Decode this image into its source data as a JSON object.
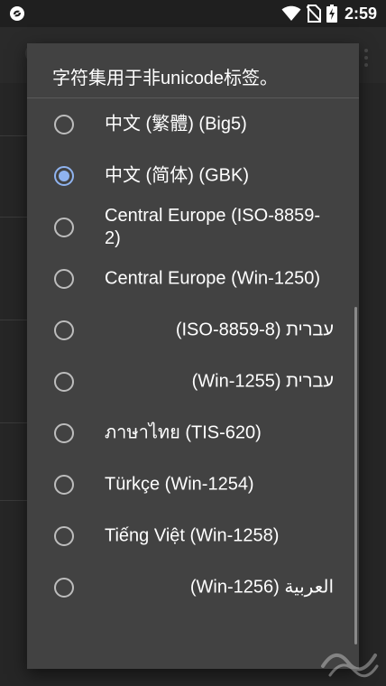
{
  "status_bar": {
    "time": "2:59",
    "icons": [
      "app-notification-icon",
      "wifi-icon",
      "no-sim-icon",
      "battery-charging-icon"
    ]
  },
  "dialog": {
    "title": "字符集用于非unicode标签。",
    "options": [
      {
        "label": "中文 (繁體) (Big5)",
        "selected": false,
        "rtl": false
      },
      {
        "label": "中文 (简体) (GBK)",
        "selected": true,
        "rtl": false
      },
      {
        "label": "Central Europe (ISO-8859-2)",
        "selected": false,
        "rtl": false
      },
      {
        "label": "Central Europe (Win-1250)",
        "selected": false,
        "rtl": false
      },
      {
        "label": "עברית (ISO-8859-8)",
        "selected": false,
        "rtl": true
      },
      {
        "label": "עברית (Win-1255)",
        "selected": false,
        "rtl": true
      },
      {
        "label": "ภาษาไทย (TIS-620)",
        "selected": false,
        "rtl": false
      },
      {
        "label": "Türkçe (Win-1254)",
        "selected": false,
        "rtl": false
      },
      {
        "label": "Tiếng Việt (Win-1258)",
        "selected": false,
        "rtl": false
      },
      {
        "label": "العربية (Win-1256)",
        "selected": false,
        "rtl": true
      }
    ]
  },
  "colors": {
    "dialog_bg": "#424242",
    "accent": "#8fb3ef",
    "text": "#ffffff"
  }
}
